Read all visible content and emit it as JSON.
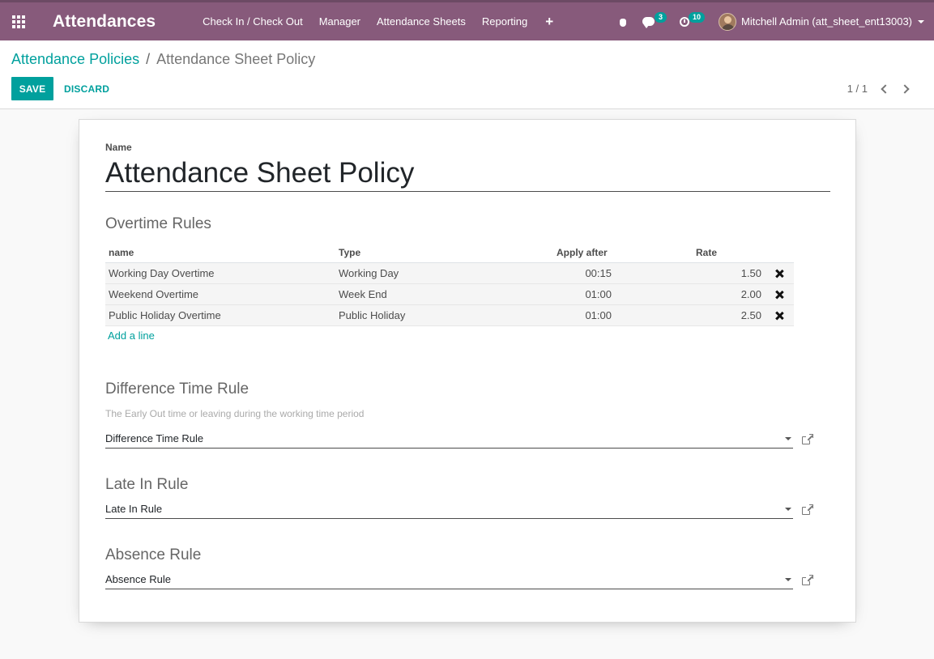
{
  "navbar": {
    "app_title": "Attendances",
    "menu": [
      "Check In / Check Out",
      "Manager",
      "Attendance Sheets",
      "Reporting"
    ],
    "plus_label": "+",
    "messages_count": "3",
    "activities_count": "10",
    "user_name": "Mitchell Admin (att_sheet_ent13003)",
    "color": "#875a7b"
  },
  "breadcrumb": {
    "parent": "Attendance Policies",
    "separator": "/",
    "current": "Attendance Sheet Policy"
  },
  "buttons": {
    "save": "SAVE",
    "discard": "DISCARD"
  },
  "pager": {
    "value": "1 / 1"
  },
  "form": {
    "name_label": "Name",
    "name_value": "Attendance Sheet Policy",
    "overtime": {
      "title": "Overtime Rules",
      "columns": [
        "name",
        "Type",
        "Apply after",
        "Rate"
      ],
      "rows": [
        {
          "name": "Working Day Overtime",
          "type": "Working Day",
          "apply_after": "00:15",
          "rate": "1.50"
        },
        {
          "name": "Weekend Overtime",
          "type": "Week End",
          "apply_after": "01:00",
          "rate": "2.00"
        },
        {
          "name": "Public Holiday Overtime",
          "type": "Public Holiday",
          "apply_after": "01:00",
          "rate": "2.50"
        }
      ],
      "add_line": "Add a line"
    },
    "difference": {
      "title": "Difference Time Rule",
      "hint": "The Early Out time or leaving during the working time period",
      "value": "Difference Time Rule"
    },
    "late_in": {
      "title": "Late In Rule",
      "value": "Late In Rule"
    },
    "absence": {
      "title": "Absence Rule",
      "value": "Absence Rule"
    }
  },
  "colors": {
    "accent": "#00a09d",
    "brand": "#875a7b"
  }
}
